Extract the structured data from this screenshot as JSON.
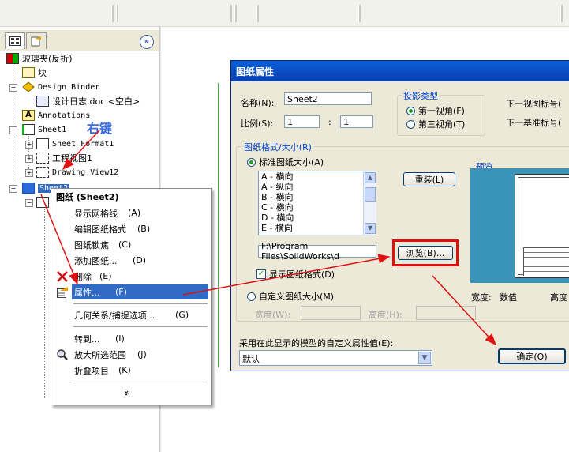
{
  "tree": {
    "root": "玻璃夹(反折)",
    "items": [
      {
        "label": "块",
        "level": 1
      },
      {
        "label": "Design Binder",
        "level": 1
      },
      {
        "label": "设计日志.doc <空白>",
        "level": 2
      },
      {
        "label": "Annotations",
        "level": 1
      },
      {
        "label": "Sheet1",
        "level": 1
      },
      {
        "label": "Sheet Format1",
        "level": 2
      },
      {
        "label": "工程视图1",
        "level": 2
      },
      {
        "label": "Drawing View12",
        "level": 2
      },
      {
        "label": "Sheet2",
        "level": 1
      }
    ]
  },
  "annotation_right_click": "右键",
  "context_menu": {
    "header": "图纸 (Sheet2)",
    "items": [
      {
        "label": "显示网格线",
        "key": "(A)"
      },
      {
        "label": "编辑图纸格式",
        "key": "(B)"
      },
      {
        "label": "图纸锁焦",
        "key": "(C)"
      },
      {
        "label": "添加图纸...",
        "key": "(D)"
      },
      {
        "label": "删除",
        "key": "(E)"
      },
      {
        "label": "属性...",
        "key": "(F)"
      },
      {
        "label": "几何关系/捕捉选项...",
        "key": "(G)"
      },
      {
        "label": "转到...",
        "key": "(I)"
      },
      {
        "label": "放大所选范围",
        "key": "(J)"
      },
      {
        "label": "折叠项目",
        "key": "(K)"
      }
    ],
    "more": "»"
  },
  "dialog": {
    "title": "图纸属性",
    "name_label": "名称(N):",
    "name_value": "Sheet2",
    "scale_label": "比例(S):",
    "scale_a": "1",
    "scale_sep": ":",
    "scale_b": "1",
    "projection_group": "投影类型",
    "first_angle": "第一视角(F)",
    "third_angle": "第三视角(T)",
    "next_view_label": "下一视图标号(",
    "next_datum_label": "下一基准标号(",
    "format_group": "图纸格式/大小(R)",
    "standard_size": "标准图纸大小(A)",
    "sizes": [
      "A - 横向",
      "A - 纵向",
      "B - 横向",
      "C - 横向",
      "D - 横向",
      "E - 横向"
    ],
    "reload_button": "重装(L)",
    "preview_label": "预览",
    "path_value": "F:\\Program Files\\SolidWorks\\d",
    "browse_button": "浏览(B)...",
    "show_format": "显示图纸格式(D)",
    "custom_size": "自定义图纸大小(M)",
    "width_label": "宽度(W):",
    "height_label": "高度(H):",
    "preview_width": "宽度:",
    "preview_width_value": "数值",
    "preview_height": "高度",
    "custom_prop_label": "采用在此显示的模型的自定义属性值(E):",
    "custom_prop_value": "默认",
    "ok_button": "确定(O)"
  },
  "colors": {
    "highlight": "#316ac5",
    "title_bar": "#0a4fc4",
    "arrow_red": "#e01010",
    "annotation_blue": "#3a6ee0",
    "preview_bg": "#3a93b8"
  }
}
